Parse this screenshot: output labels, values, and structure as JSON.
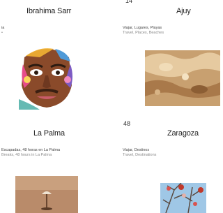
{
  "cards": [
    {
      "number": "",
      "title": "Ibrahima Sarr",
      "category_es": "ia",
      "category_en": "•",
      "image": "portrait-illustration"
    },
    {
      "number": "14",
      "title": "Ajuy",
      "category_es": "Viajar, Lugares, Playas",
      "category_en": "Travel, Places, Beaches",
      "image": "sand-rock-photo"
    },
    {
      "number": "",
      "title": "La Palma",
      "category_es": "Escapadas, 48 horas en La Palma",
      "category_en": "Breaks, 48 hours in La Palma",
      "image": "lamp-photo"
    },
    {
      "number": "48",
      "title": "Zaragoza",
      "category_es": "Viajar, Destinos",
      "category_en": "Travel, Destinations",
      "image": "tree-sky-photo"
    }
  ]
}
